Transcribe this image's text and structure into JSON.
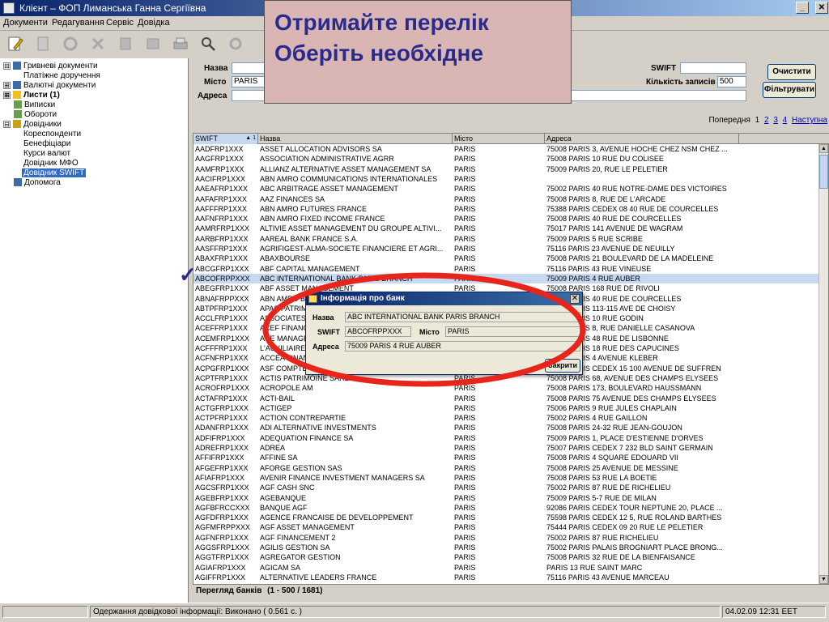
{
  "window": {
    "title": "Клієнт – ФОП Лиманська Ганна Сергіївна",
    "btn_min": "_",
    "btn_max": "▫",
    "btn_close": "✕"
  },
  "menu": [
    "Документи",
    "Редагування",
    "Сервіс",
    "Довідка"
  ],
  "overlay": {
    "line1": "Отримайте перелік",
    "line2": "Оберіть необхідне"
  },
  "tree": [
    {
      "label": "Гривневі документи",
      "exp": "⊟"
    },
    {
      "label": "Платіжне доручення",
      "exp": ""
    },
    {
      "label": "Валютні документи",
      "exp": "⊞"
    },
    {
      "label": "Листи (1)",
      "exp": "⊞"
    },
    {
      "label": "Виписки",
      "exp": ""
    },
    {
      "label": "Обороти",
      "exp": ""
    },
    {
      "label": "Довідники",
      "exp": "⊟"
    },
    {
      "label": "Кореспонденти",
      "exp": ""
    },
    {
      "label": "Бенефіціари",
      "exp": ""
    },
    {
      "label": "Курси валют",
      "exp": ""
    },
    {
      "label": "Довідник МФО",
      "exp": ""
    },
    {
      "label": "Довідник SWIFT",
      "exp": ""
    },
    {
      "label": "Допомога",
      "exp": ""
    }
  ],
  "filter": {
    "name_label": "Назва",
    "name_value": "",
    "city_label": "Місто",
    "city_value": "PARIS",
    "address_label": "Адреса",
    "address_value": "",
    "swift_label": "SWIFT",
    "swift_value": "",
    "count_label": "Кількість записів",
    "count_value": "500",
    "clear_button": "Очистити",
    "filter_button": "Фільтрувати"
  },
  "pager": {
    "prev": "Попередня",
    "pages": [
      "1",
      "2",
      "3",
      "4"
    ],
    "next": "Наступна"
  },
  "grid": {
    "columns": [
      "SWIFT",
      "Назва",
      "Місто",
      "Адреса"
    ],
    "sort_indicator": "▲ 1",
    "selected_index": 13,
    "rows": [
      [
        "AADFRP1XXX",
        "ASSET ALLOCATION ADVISORS SA",
        "PARIS",
        "75008 PARIS 3, AVENUE HOCHE CHEZ NSM CHEZ ..."
      ],
      [
        "AAGFRP1XXX",
        "ASSOCIATION ADMINISTRATIVE AGRR",
        "PARIS",
        "75008 PARIS 10 RUE DU COLISEE"
      ],
      [
        "AAMFRP1XXX",
        "ALLIANZ ALTERNATIVE ASSET MANAGEMENT SA",
        "PARIS",
        "75009 PARIS 20, RUE LE PELETIER"
      ],
      [
        "AACIFRP1XXX",
        "ABN AMRO COMMUNICATIONS INTERNATIONALES",
        "PARIS",
        ""
      ],
      [
        "AAEAFRP1XXX",
        "ABC ARBITRAGE ASSET MANAGEMENT",
        "PARIS",
        "75002 PARIS 40 RUE NOTRE-DAME DES VICTOIRES"
      ],
      [
        "AAFAFRP1XXX",
        "AAZ FINANCES SA",
        "PARIS",
        "75008 PARIS 8, RUE DE L'ARCADE"
      ],
      [
        "AAFFFRP1XXX",
        "ABN AMRO FUTURES FRANCE",
        "PARIS",
        "75388 PARIS CEDEX 08 40 RUE DE COURCELLES"
      ],
      [
        "AAFNFRP1XXX",
        "ABN AMRO FIXED INCOME FRANCE",
        "PARIS",
        "75008 PARIS 40 RUE DE COURCELLES"
      ],
      [
        "AAMRFRP1XXX",
        "ALTIVIE ASSET MANAGEMENT DU GROUPE ALTIVI...",
        "PARIS",
        "75017 PARIS 141 AVENUE DE WAGRAM"
      ],
      [
        "AARBFRP1XXX",
        "AAREAL BANK FRANCE S.A.",
        "PARIS",
        "75009 PARIS 5 RUE SCRIBE"
      ],
      [
        "AASFFRP1XXX",
        "AGRIFIGEST-ALMA-SOCIETE FINANCIERE ET AGRI...",
        "PARIS",
        "75116 PARIS 23 AVENUE DE NEUILLY"
      ],
      [
        "ABAXFRP1XXX",
        "ABAXBOURSE",
        "PARIS",
        "75008 PARIS 21 BOULEVARD DE LA MADELEINE"
      ],
      [
        "ABCGFRP1XXX",
        "ABF CAPITAL MANAGEMENT",
        "PARIS",
        "75116 PARIS 43 RUE VINEUSE"
      ],
      [
        "ABCOFRPPXXX",
        "ABC INTERNATIONAL BANK PARIS BRANCH",
        "PARIS",
        "75009 PARIS 4 RUE AUBER"
      ],
      [
        "ABEGFRP1XXX",
        "ABF ASSET MANAGEMENT",
        "PARIS",
        "75008 PARIS 168 RUE DE RIVOLI"
      ],
      [
        "ABNAFRPPXXX",
        "ABN AMRO BANK N.V.",
        "PARIS",
        "75008 PARIS 40 RUE DE COURCELLES"
      ],
      [
        "ABTPFRP1XXX",
        "APAS PATRIMOINE",
        "PARIS",
        "75008 PARIS 113-115 AVE DE CHOISY"
      ],
      [
        "ACCLFRP1XXX",
        "ASSOCIATES",
        "PARIS",
        "75008 PARIS 10 RUE GODIN"
      ],
      [
        "ACEFFRP1XXX",
        "ACEF FINANCE",
        "PARIS",
        "75008 PARIS 8, RUE DANIELLE CASANOVA"
      ],
      [
        "ACEMFRP1XXX",
        "ACE MANAGEMENT",
        "PARIS",
        "75008 PARIS 48 RUE DE LISBONNE"
      ],
      [
        "ACFFFRP1XXX",
        "L'AUXILIAIRE",
        "PARIS",
        "75008 PARIS 18 RUE DES CAPUCINES"
      ],
      [
        "ACFNFRP1XXX",
        "ACCEA FINANCE",
        "PARIS",
        "75008 PARIS 4 AVENUE KLEBER"
      ],
      [
        "ACPGFRP1XXX",
        "ASF COMPTE",
        "PARIS",
        "75008 PARIS CEDEX 15 100 AVENUE DE SUFFREN"
      ],
      [
        "ACPTFRP1XXX",
        "ACTIS PATRIMOINE SARL",
        "PARIS",
        "75008 PARIS 68, AVENUE DES CHAMPS ELYSEES"
      ],
      [
        "ACROFRP1XXX",
        "ACROPOLE AM",
        "PARIS",
        "75008 PARIS 173, BOULEVARD HAUSSMANN"
      ],
      [
        "ACTAFRP1XXX",
        "ACTI-BAIL",
        "PARIS",
        "75008 PARIS 75 AVENUE DES CHAMPS ELYSEES"
      ],
      [
        "ACTGFRP1XXX",
        "ACTIGEP",
        "PARIS",
        "75006 PARIS 9 RUE JULES CHAPLAIN"
      ],
      [
        "ACTPFRP1XXX",
        "ACTION CONTREPARTIE",
        "PARIS",
        "75002 PARIS 4 RUE GAILLON"
      ],
      [
        "ADANFRP1XXX",
        "ADI ALTERNATIVE INVESTMENTS",
        "PARIS",
        "75008 PARIS 24-32 RUE JEAN-GOUJON"
      ],
      [
        "ADFIFRP1XXX",
        "ADEQUATION FINANCE SA",
        "PARIS",
        "75009 PARIS 1, PLACE D'ESTIENNE D'ORVES"
      ],
      [
        "ADREFRP1XXX",
        "ADREA",
        "PARIS",
        "75007 PARIS CEDEX 7 232 BLD SAINT GERMAIN"
      ],
      [
        "AFFIFRP1XXX",
        "AFFINE SA",
        "PARIS",
        "75008 PARIS 4 SQUARE EDOUARD VII"
      ],
      [
        "AFGEFRP1XXX",
        "AFORGE GESTION SAS",
        "PARIS",
        "75008 PARIS 25 AVENUE DE MESSINE"
      ],
      [
        "AFIAFRP1XXX",
        "AVENIR FINANCE INVESTMENT MANAGERS SA",
        "PARIS",
        "75008 PARIS 53 RUE LA BOETIE"
      ],
      [
        "AGCSFRP1XXX",
        "AGF CASH SNC",
        "PARIS",
        "75002 PARIS 87 RUE DE RICHELIEU"
      ],
      [
        "AGEBFRP1XXX",
        "AGEBANQUE",
        "PARIS",
        "75009 PARIS 5-7 RUE DE MILAN"
      ],
      [
        "AGFBFRCCXXX",
        "BANQUE AGF",
        "PARIS",
        "92086 PARIS CEDEX TOUR NEPTUNE 20, PLACE ..."
      ],
      [
        "AGFDFRP1XXX",
        "AGENCE FRANCAISE DE DEVELOPPEMENT",
        "PARIS",
        "75598 PARIS CEDEX 12 5, RUE ROLAND BARTHES"
      ],
      [
        "AGFMFRPPXXX",
        "AGF ASSET MANAGEMENT",
        "PARIS",
        "75444 PARIS CEDEX 09 20 RUE LE PELETIER"
      ],
      [
        "AGFNFRP1XXX",
        "AGF FINANCEMENT 2",
        "PARIS",
        "75002 PARIS 87 RUE RICHELIEU"
      ],
      [
        "AGGSFRP1XXX",
        "AGILIS GESTION SA",
        "PARIS",
        "75002 PARIS PALAIS BROGNIART PLACE BRONG..."
      ],
      [
        "AGGTFRP1XXX",
        "AGREGATOR GESTION",
        "PARIS",
        "75008 PARIS 32 RUE DE LA BIENFAISANCE"
      ],
      [
        "AGIAFRP1XXX",
        "AGICAM SA",
        "PARIS",
        "PARIS 13 RUE SAINT MARC"
      ],
      [
        "AGIFFRP1XXX",
        "ALTERNATIVE LEADERS FRANCE",
        "PARIS",
        "75116 PARIS 43 AVENUE MARCEAU"
      ]
    ]
  },
  "grid_footer": {
    "label": "Перегляд банків",
    "value": "(1 - 500 / 1681)"
  },
  "status": {
    "left": "",
    "message": "Одержання довідкової інформації: Виконано ( 0.561 c. )",
    "datetime": "04.02.09 12:31 EET"
  },
  "dialog": {
    "title": "Інформація про банк",
    "name_label": "Назва",
    "name_value": "ABC INTERNATIONAL BANK PARIS BRANCH",
    "swift_label": "SWIFT",
    "swift_value": "ABCOFRPPXXX",
    "city_label": "Місто",
    "city_value": "PARIS",
    "address_label": "Адреса",
    "address_value": "75009 PARIS 4 RUE AUBER",
    "close_button": "Закрити"
  },
  "annotation": {
    "checkmark": "✓",
    "ellipse_color": "#e8251b"
  }
}
